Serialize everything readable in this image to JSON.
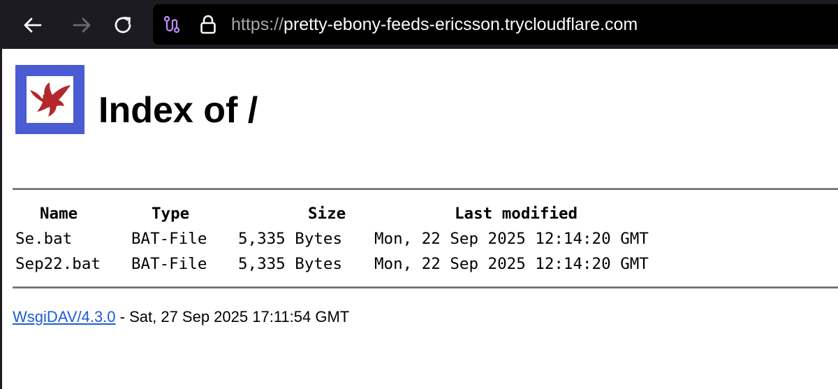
{
  "browser": {
    "url_scheme": "https://",
    "url_host": "pretty-ebony-feeds-ericsson.trycloudflare.com",
    "icons": {
      "back": "arrow-left-icon",
      "forward": "arrow-right-icon",
      "reload": "reload-icon",
      "route": "route-icon",
      "lock": "lock-icon"
    }
  },
  "page": {
    "logo": "bird-logo",
    "title": "Index of /",
    "columns": {
      "name": "Name",
      "type": "Type",
      "size": "Size",
      "modified": "Last modified"
    },
    "files": [
      {
        "name": "Se.bat",
        "type": "BAT-File",
        "size": "5,335 Bytes",
        "modified": "Mon, 22 Sep 2025 12:14:20 GMT"
      },
      {
        "name": "Sep22.bat",
        "type": "BAT-File",
        "size": "5,335 Bytes",
        "modified": "Mon, 22 Sep 2025 12:14:20 GMT"
      }
    ],
    "footer": {
      "link_text": "WsgiDAV/4.3.0",
      "text": " - Sat, 27 Sep 2025 17:11:54 GMT"
    }
  },
  "colors": {
    "toolbar": "#1c1b22",
    "urlbar": "#000000",
    "logo_frame": "#4a5bd3",
    "logo_bird": "#b3282c",
    "link": "#1d5bd6"
  }
}
